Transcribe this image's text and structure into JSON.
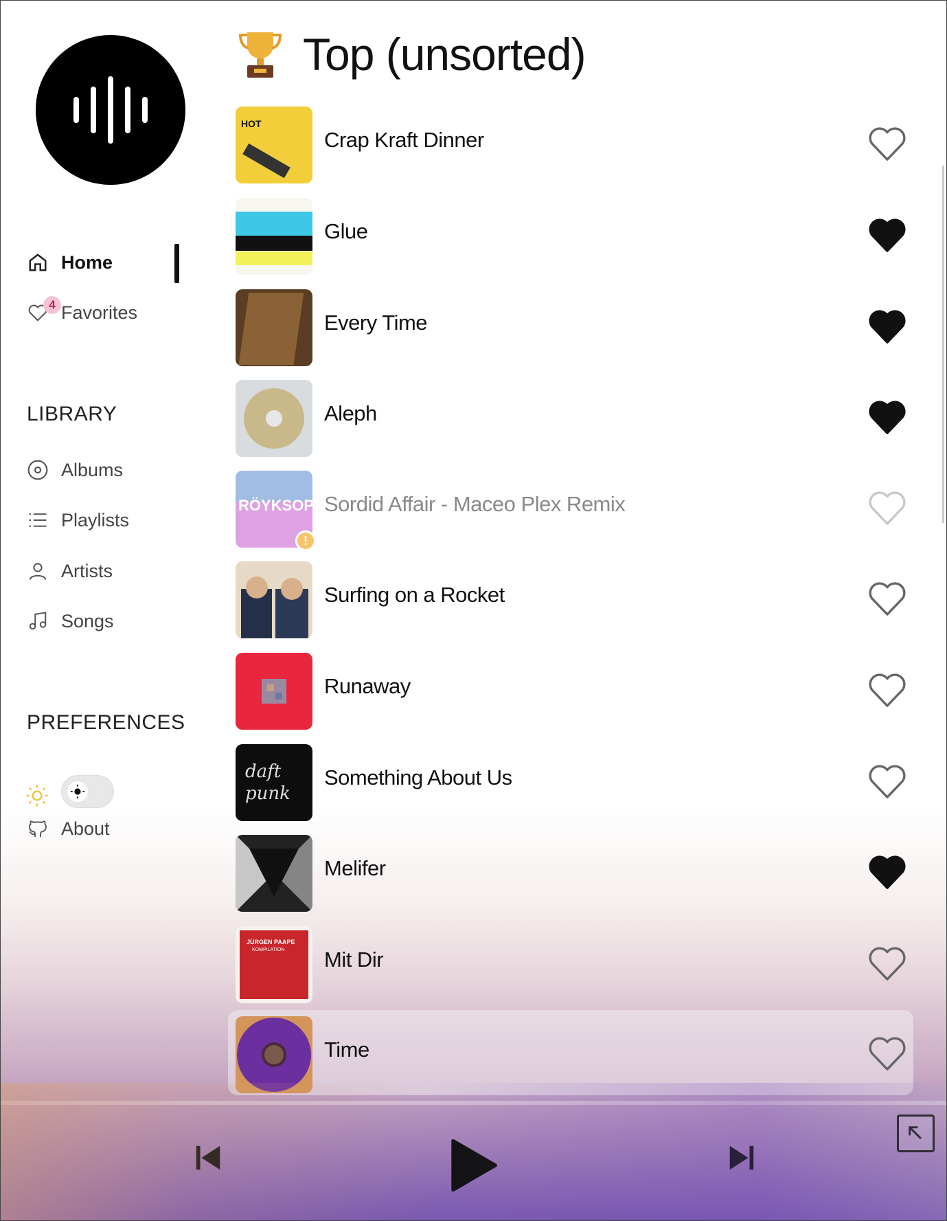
{
  "sidebar": {
    "nav": [
      {
        "label": "Home",
        "icon": "home-icon",
        "active": true
      },
      {
        "label": "Favorites",
        "icon": "heart-icon",
        "badge": "4"
      }
    ],
    "library_title": "LIBRARY",
    "library": [
      {
        "label": "Albums",
        "icon": "disc-icon"
      },
      {
        "label": "Playlists",
        "icon": "list-icon"
      },
      {
        "label": "Artists",
        "icon": "user-icon"
      },
      {
        "label": "Songs",
        "icon": "music-note-icon"
      }
    ],
    "preferences_title": "PREFERENCES",
    "about_label": "About"
  },
  "main": {
    "title": "Top (unsorted)",
    "songs": [
      {
        "title": "Crap Kraft Dinner",
        "favorite": false,
        "art_color": "#f2cf3a"
      },
      {
        "title": "Glue",
        "favorite": true,
        "art_color": "#35c6e0"
      },
      {
        "title": "Every Time",
        "favorite": true,
        "art_color": "#6b4a2a"
      },
      {
        "title": "Aleph",
        "favorite": true,
        "art_color": "#cfd3d6"
      },
      {
        "title": "Sordid Affair - Maceo Plex Remix",
        "favorite": false,
        "unavailable": true,
        "art_color": "#c98ad6"
      },
      {
        "title": "Surfing on a Rocket",
        "favorite": false,
        "art_color": "#d8c8b0"
      },
      {
        "title": "Runaway",
        "favorite": false,
        "art_color": "#e8263d"
      },
      {
        "title": "Something About Us",
        "favorite": false,
        "art_color": "#111111"
      },
      {
        "title": "Melifer",
        "favorite": true,
        "art_color": "#333333"
      },
      {
        "title": "Mit Dir",
        "favorite": false,
        "art_color": "#c8262a"
      },
      {
        "title": "Time",
        "favorite": false,
        "art_color": "#6b2fa0",
        "highlighted": true
      }
    ]
  },
  "colors": {
    "accent": "#111111",
    "badge_bg": "#f6c4d4",
    "badge_text": "#c2185b",
    "sun": "#f0c040"
  }
}
